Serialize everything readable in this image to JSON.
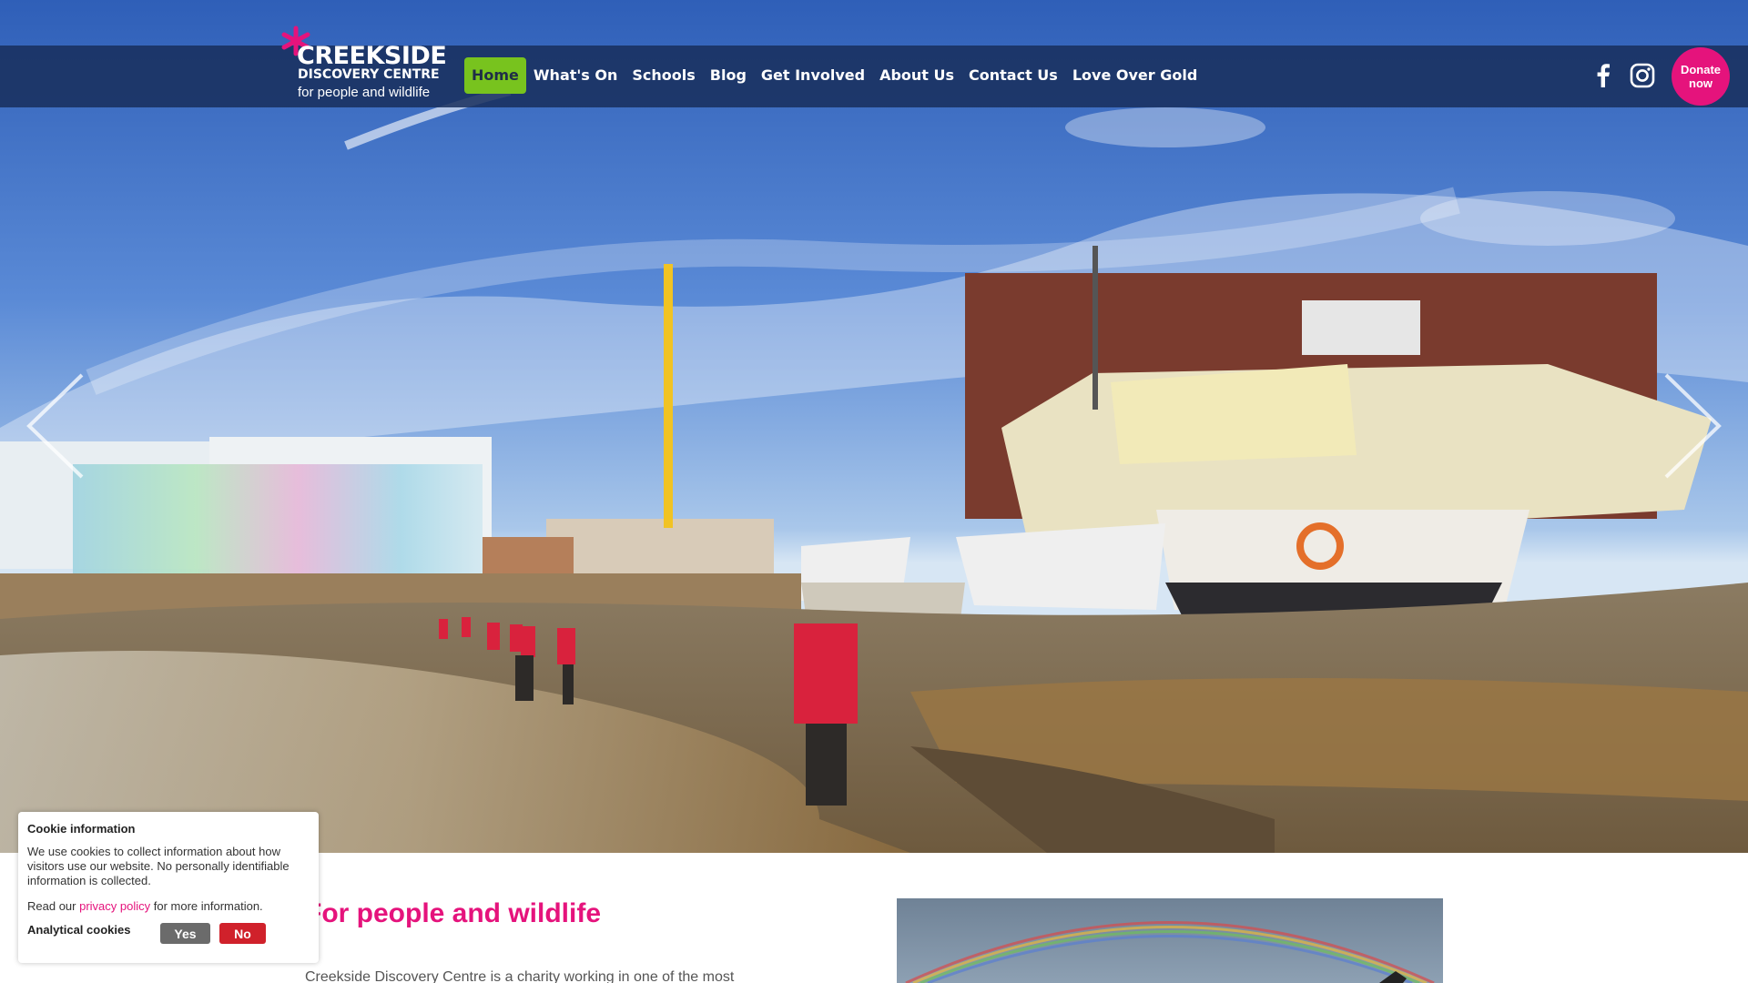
{
  "brand": {
    "name": "CREEKSIDE",
    "subtitle": "DISCOVERY CENTRE",
    "tagline": "for people and wildlife"
  },
  "nav": {
    "items": [
      {
        "label": "Home",
        "active": true
      },
      {
        "label": "What's On",
        "active": false
      },
      {
        "label": "Schools",
        "active": false
      },
      {
        "label": "Blog",
        "active": false
      },
      {
        "label": "Get Involved",
        "active": false
      },
      {
        "label": "About Us",
        "active": false
      },
      {
        "label": "Contact Us",
        "active": false
      },
      {
        "label": "Love Over Gold",
        "active": false
      }
    ]
  },
  "social": {
    "icons": [
      "facebook-icon",
      "instagram-icon"
    ]
  },
  "donate": {
    "line1": "Donate",
    "line2": "now"
  },
  "hero": {
    "prev_icon": "chevron-left-icon",
    "next_icon": "chevron-right-icon"
  },
  "content": {
    "heading": "For people and wildlife",
    "intro": "Creekside Discovery Centre is a charity working in one of the most"
  },
  "cookie": {
    "title": "Cookie information",
    "body": "We use cookies to collect information about how visitors use our website. No personally identifiable information is collected.",
    "read_prefix": "Read our ",
    "privacy_link": "privacy policy",
    "read_suffix": " for more information.",
    "analytics_label": "Analytical cookies",
    "yes_label": "Yes",
    "no_label": "No"
  },
  "colors": {
    "brand_pink": "#e5137c",
    "nav_active": "#78c31e",
    "header_bg": "#182e5c",
    "cookie_no": "#d0212b",
    "cookie_yes": "#6b6b6b"
  }
}
